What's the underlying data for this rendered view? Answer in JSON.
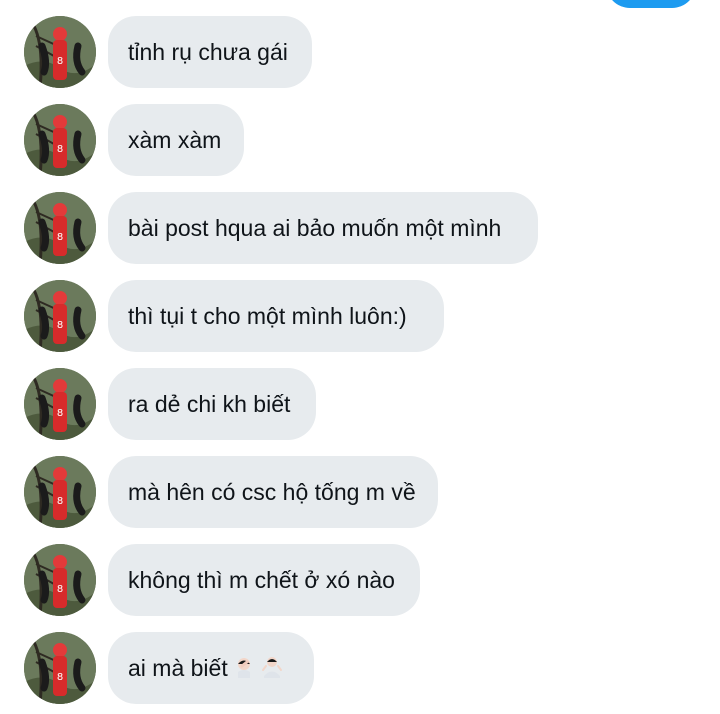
{
  "conversation": {
    "messages": [
      {
        "text": "tỉnh rụ chưa gái"
      },
      {
        "text": "xàm xàm"
      },
      {
        "text": "bài post hqua ai bảo muốn một mình"
      },
      {
        "text": "thì tụi t cho một mình luôn:)"
      },
      {
        "text": "ra dẻ chi kh biết"
      },
      {
        "text": "mà hên có csc hộ tống m về"
      },
      {
        "text": "không thì m chết ở xó nào"
      },
      {
        "text": "ai mà biết",
        "emojis": [
          "facepalm-emoji",
          "shrug-emoji"
        ]
      }
    ]
  },
  "colors": {
    "incoming_bubble": "#e7ebee",
    "outgoing_bubble": "#1d9bf0",
    "text": "#0f1419"
  }
}
